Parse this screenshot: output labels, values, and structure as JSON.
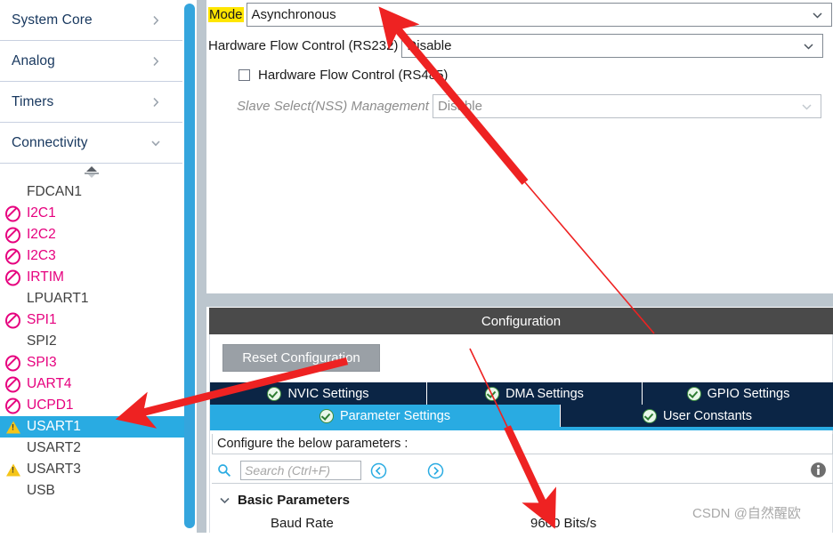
{
  "sidebar": {
    "categories": [
      {
        "label": "System Core",
        "icon": "chevron-right-icon",
        "expanded": false
      },
      {
        "label": "Analog",
        "icon": "chevron-right-icon",
        "expanded": false
      },
      {
        "label": "Timers",
        "icon": "chevron-right-icon",
        "expanded": false
      },
      {
        "label": "Connectivity",
        "icon": "chevron-down-icon",
        "expanded": true
      }
    ],
    "scroll_widget_icon": "scroll-up-icon",
    "peripherals": [
      {
        "label": "FDCAN1",
        "icon": "none",
        "state": "normal"
      },
      {
        "label": "I2C1",
        "icon": "prohibit-icon",
        "state": "disabled"
      },
      {
        "label": "I2C2",
        "icon": "prohibit-icon",
        "state": "disabled"
      },
      {
        "label": "I2C3",
        "icon": "prohibit-icon",
        "state": "disabled"
      },
      {
        "label": "IRTIM",
        "icon": "prohibit-icon",
        "state": "disabled"
      },
      {
        "label": "LPUART1",
        "icon": "none",
        "state": "normal"
      },
      {
        "label": "SPI1",
        "icon": "prohibit-icon",
        "state": "disabled"
      },
      {
        "label": "SPI2",
        "icon": "none",
        "state": "normal"
      },
      {
        "label": "SPI3",
        "icon": "prohibit-icon",
        "state": "disabled"
      },
      {
        "label": "UART4",
        "icon": "prohibit-icon",
        "state": "disabled"
      },
      {
        "label": "UCPD1",
        "icon": "prohibit-icon",
        "state": "disabled"
      },
      {
        "label": "USART1",
        "icon": "warning-icon",
        "state": "selected"
      },
      {
        "label": "USART2",
        "icon": "none",
        "state": "normal"
      },
      {
        "label": "USART3",
        "icon": "warning-icon",
        "state": "normal"
      },
      {
        "label": "USB",
        "icon": "none",
        "state": "normal"
      }
    ]
  },
  "form": {
    "mode": {
      "label": "Mode",
      "value": "Asynchronous",
      "highlighted": true,
      "dropdown_icon": "chevron-down-icon"
    },
    "flow_control_rs232": {
      "label": "Hardware Flow Control (RS232)",
      "value": "Disable",
      "dropdown_icon": "chevron-down-icon"
    },
    "flow_control_rs485": {
      "label": "Hardware Flow Control (RS485)",
      "checked": false,
      "icon": "checkbox-icon"
    },
    "nss_management": {
      "label": "Slave Select(NSS) Management",
      "value": "Disable",
      "disabled": true,
      "dropdown_icon": "chevron-down-icon"
    }
  },
  "configuration": {
    "title": "Configuration",
    "reset_button": "Reset Configuration",
    "tabs_top": [
      {
        "label": "NVIC Settings",
        "icon": "check-circle-icon",
        "active": false
      },
      {
        "label": "DMA Settings",
        "icon": "check-circle-icon",
        "active": false
      },
      {
        "label": "GPIO Settings",
        "icon": "check-circle-icon",
        "active": false
      }
    ],
    "tabs_bottom": [
      {
        "label": "Parameter Settings",
        "icon": "check-circle-icon",
        "active": true
      },
      {
        "label": "User Constants",
        "icon": "check-circle-icon",
        "active": false
      }
    ],
    "note": "Configure the below parameters :",
    "search": {
      "placeholder": "Search (Ctrl+F)",
      "value": "",
      "icon": "search-icon",
      "prev_icon": "nav-prev-icon",
      "next_icon": "nav-next-icon"
    },
    "info_icon": "info-icon",
    "groups": [
      {
        "label": "Basic Parameters",
        "expanded": true,
        "chevron_icon": "chevron-down-icon",
        "parameters": [
          {
            "name": "Baud Rate",
            "value": "9600 Bits/s"
          }
        ]
      }
    ]
  },
  "watermark": "CSDN @自然醒欧",
  "annotations": {
    "arrow_color": "#ee2222",
    "arrows": [
      {
        "name": "arrow-to-mode-field",
        "from": [
          735,
          375
        ],
        "to": [
          437,
          22
        ]
      },
      {
        "name": "arrow-to-usart1",
        "from": [
          390,
          408
        ],
        "to": [
          146,
          468
        ]
      },
      {
        "name": "arrow-to-baud-rate",
        "from": [
          528,
          392
        ],
        "to": [
          617,
          580
        ]
      }
    ]
  },
  "colors": {
    "accent_blue": "#29abe2",
    "tab_navy": "#0b2545",
    "disabled_magenta": "#e6007e",
    "warning_yellow": "#f5c518",
    "highlight_yellow": "#ffe600",
    "config_header_gray": "#4a4a4a"
  }
}
